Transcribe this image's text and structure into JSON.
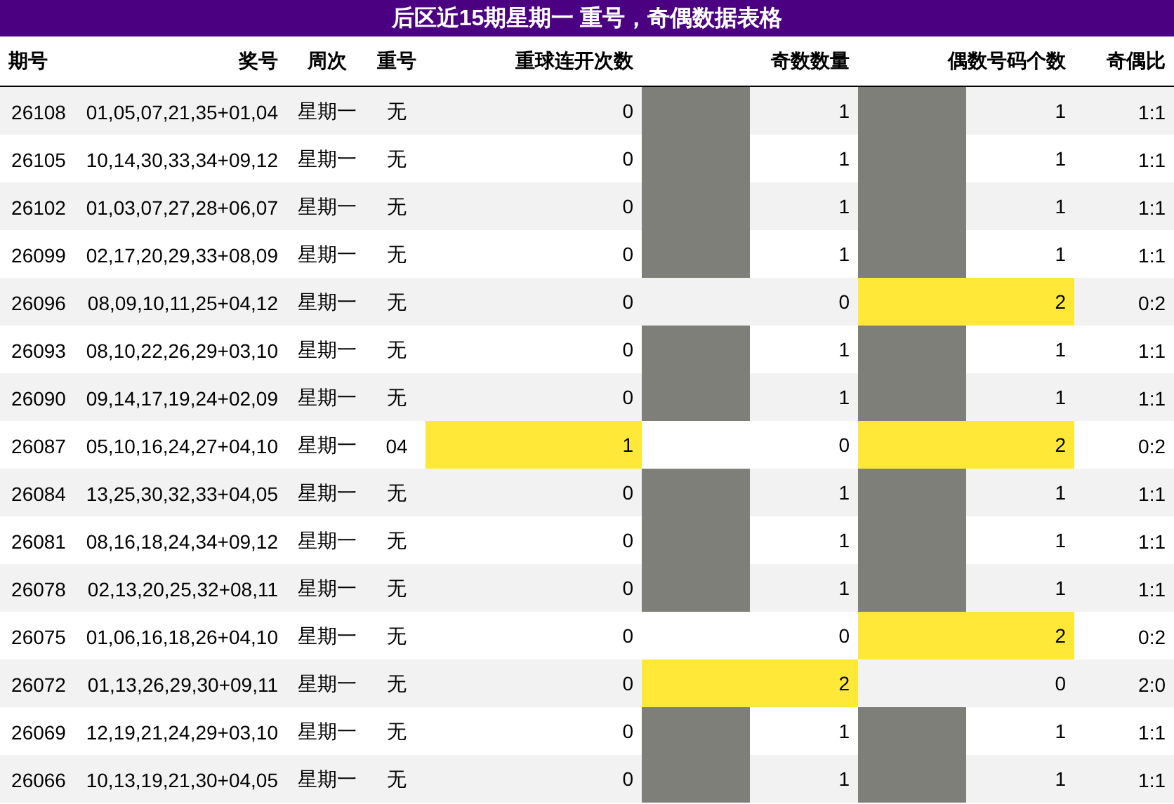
{
  "title": "后区近15期星期一 重号，奇偶数据表格",
  "columns": [
    "期号",
    "奖号",
    "周次",
    "重号",
    "重球连开次数",
    "奇数数量",
    "偶数号码个数",
    "奇偶比"
  ],
  "rows": [
    {
      "issue": "26108",
      "numbers": "01,05,07,21,35+01,04",
      "weekday": "星期一",
      "repeat": "无",
      "repeat_count": {
        "text": "0"
      },
      "odd_count": {
        "text": "1",
        "level": 0.5
      },
      "even_count": {
        "text": "1",
        "level": 0.5
      },
      "ratio": "1:1"
    },
    {
      "issue": "26105",
      "numbers": "10,14,30,33,34+09,12",
      "weekday": "星期一",
      "repeat": "无",
      "repeat_count": {
        "text": "0"
      },
      "odd_count": {
        "text": "1",
        "level": 0.5
      },
      "even_count": {
        "text": "1",
        "level": 0.5
      },
      "ratio": "1:1"
    },
    {
      "issue": "26102",
      "numbers": "01,03,07,27,28+06,07",
      "weekday": "星期一",
      "repeat": "无",
      "repeat_count": {
        "text": "0"
      },
      "odd_count": {
        "text": "1",
        "level": 0.5
      },
      "even_count": {
        "text": "1",
        "level": 0.5
      },
      "ratio": "1:1"
    },
    {
      "issue": "26099",
      "numbers": "02,17,20,29,33+08,09",
      "weekday": "星期一",
      "repeat": "无",
      "repeat_count": {
        "text": "0"
      },
      "odd_count": {
        "text": "1",
        "level": 0.5
      },
      "even_count": {
        "text": "1",
        "level": 0.5
      },
      "ratio": "1:1"
    },
    {
      "issue": "26096",
      "numbers": "08,09,10,11,25+04,12",
      "weekday": "星期一",
      "repeat": "无",
      "repeat_count": {
        "text": "0"
      },
      "odd_count": {
        "text": "0"
      },
      "even_count": {
        "text": "2",
        "level": 1
      },
      "ratio": "0:2"
    },
    {
      "issue": "26093",
      "numbers": "08,10,22,26,29+03,10",
      "weekday": "星期一",
      "repeat": "无",
      "repeat_count": {
        "text": "0"
      },
      "odd_count": {
        "text": "1",
        "level": 0.5
      },
      "even_count": {
        "text": "1",
        "level": 0.5
      },
      "ratio": "1:1"
    },
    {
      "issue": "26090",
      "numbers": "09,14,17,19,24+02,09",
      "weekday": "星期一",
      "repeat": "无",
      "repeat_count": {
        "text": "0"
      },
      "odd_count": {
        "text": "1",
        "level": 0.5
      },
      "even_count": {
        "text": "1",
        "level": 0.5
      },
      "ratio": "1:1"
    },
    {
      "issue": "26087",
      "numbers": "05,10,16,24,27+04,10",
      "weekday": "星期一",
      "repeat": "04",
      "repeat_count": {
        "text": "1",
        "level": 1
      },
      "odd_count": {
        "text": "0"
      },
      "even_count": {
        "text": "2",
        "level": 1
      },
      "ratio": "0:2"
    },
    {
      "issue": "26084",
      "numbers": "13,25,30,32,33+04,05",
      "weekday": "星期一",
      "repeat": "无",
      "repeat_count": {
        "text": "0"
      },
      "odd_count": {
        "text": "1",
        "level": 0.5
      },
      "even_count": {
        "text": "1",
        "level": 0.5
      },
      "ratio": "1:1"
    },
    {
      "issue": "26081",
      "numbers": "08,16,18,24,34+09,12",
      "weekday": "星期一",
      "repeat": "无",
      "repeat_count": {
        "text": "0"
      },
      "odd_count": {
        "text": "1",
        "level": 0.5
      },
      "even_count": {
        "text": "1",
        "level": 0.5
      },
      "ratio": "1:1"
    },
    {
      "issue": "26078",
      "numbers": "02,13,20,25,32+08,11",
      "weekday": "星期一",
      "repeat": "无",
      "repeat_count": {
        "text": "0"
      },
      "odd_count": {
        "text": "1",
        "level": 0.5
      },
      "even_count": {
        "text": "1",
        "level": 0.5
      },
      "ratio": "1:1"
    },
    {
      "issue": "26075",
      "numbers": "01,06,16,18,26+04,10",
      "weekday": "星期一",
      "repeat": "无",
      "repeat_count": {
        "text": "0"
      },
      "odd_count": {
        "text": "0"
      },
      "even_count": {
        "text": "2",
        "level": 1
      },
      "ratio": "0:2"
    },
    {
      "issue": "26072",
      "numbers": "01,13,26,29,30+09,11",
      "weekday": "星期一",
      "repeat": "无",
      "repeat_count": {
        "text": "0"
      },
      "odd_count": {
        "text": "2",
        "level": 1
      },
      "even_count": {
        "text": "0"
      },
      "ratio": "2:0"
    },
    {
      "issue": "26069",
      "numbers": "12,19,21,24,29+03,10",
      "weekday": "星期一",
      "repeat": "无",
      "repeat_count": {
        "text": "0"
      },
      "odd_count": {
        "text": "1",
        "level": 0.5
      },
      "even_count": {
        "text": "1",
        "level": 0.5
      },
      "ratio": "1:1"
    },
    {
      "issue": "26066",
      "numbers": "10,13,19,21,30+04,05",
      "weekday": "星期一",
      "repeat": "无",
      "repeat_count": {
        "text": "0"
      },
      "odd_count": {
        "text": "1",
        "level": 0.5
      },
      "even_count": {
        "text": "1",
        "level": 0.5
      },
      "ratio": "1:1"
    }
  ]
}
